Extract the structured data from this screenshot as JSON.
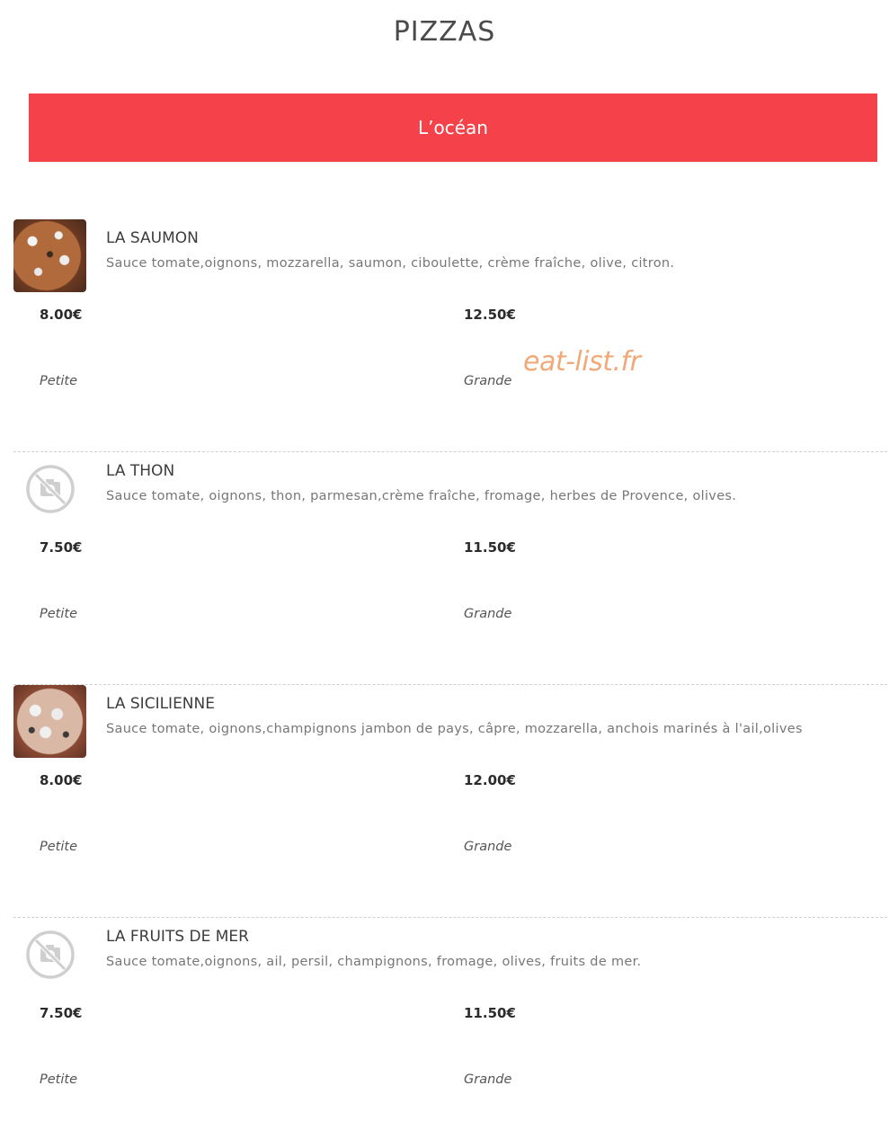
{
  "page": {
    "title": "PIZZAS"
  },
  "category": {
    "label": "L’océan",
    "color": "#f5424a"
  },
  "watermark": "eat-list.fr",
  "sizes": {
    "small": "Petite",
    "large": "Grande"
  },
  "items": [
    {
      "name": "LA SAUMON",
      "description": "Sauce tomate,oignons, mozzarella, saumon, ciboulette, crème fraîche, olive, citron.",
      "image": "pizza-photo",
      "price_small": "8.00€",
      "price_large": "12.50€"
    },
    {
      "name": "LA THON",
      "description": "Sauce tomate, oignons, thon, parmesan,crème fraîche, fromage, herbes de Provence, olives.",
      "image": "no-photo-icon",
      "price_small": "7.50€",
      "price_large": "11.50€"
    },
    {
      "name": "LA SICILIENNE",
      "description": "Sauce tomate, oignons,champignons jambon de pays, câpre, mozzarella, anchois marinés à l'ail,olives",
      "image": "pizza-photo",
      "price_small": "8.00€",
      "price_large": "12.00€"
    },
    {
      "name": "LA FRUITS DE MER",
      "description": "Sauce tomate,oignons, ail, persil, champignons, fromage, olives, fruits de mer.",
      "image": "no-photo-icon",
      "price_small": "7.50€",
      "price_large": "11.50€"
    }
  ]
}
